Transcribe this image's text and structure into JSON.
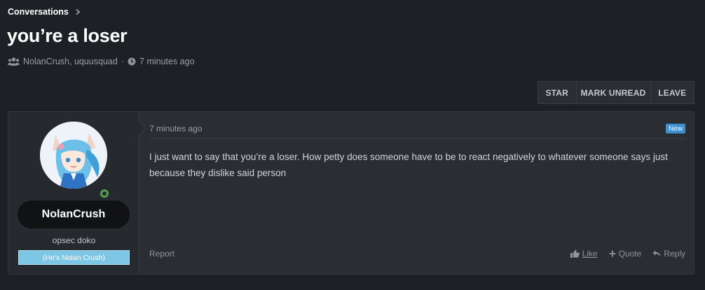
{
  "breadcrumb": {
    "label": "Conversations"
  },
  "title": "you’re a loser",
  "meta": {
    "participants": "NolanCrush, uquusquad",
    "separator": "·",
    "time": "7 minutes ago",
    "icons": [
      "users-icon",
      "clock-icon"
    ]
  },
  "actions": {
    "star": "STAR",
    "mark_unread": "MARK UNREAD",
    "leave": "LEAVE"
  },
  "message": {
    "time": "7 minutes ago",
    "badge": "New",
    "body": "I just want to say that you’re a loser. How petty does someone have to be to react negatively to whatever someone says just because they dislike said person",
    "author": {
      "username": "NolanCrush",
      "user_title": "opsec doko",
      "banner": "(He's Nolan Crush)",
      "online": true
    },
    "footer": {
      "report": "Report",
      "like": "Like",
      "quote": "Quote",
      "reply": "Reply"
    }
  },
  "colors": {
    "background": "#1d2024",
    "panel": "#2a2d32",
    "banner": "#7ec6e6",
    "badge": "#3d8fd0",
    "online": "#56a24a"
  }
}
